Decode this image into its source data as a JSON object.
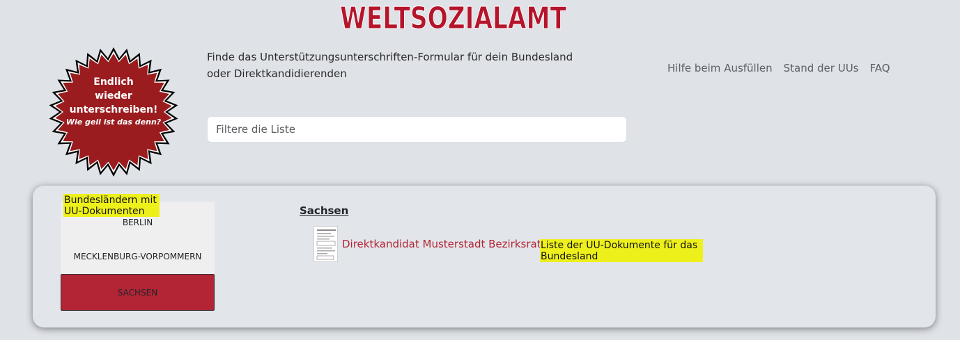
{
  "logo": {
    "text": "WELTSOZIALAMT"
  },
  "badge": {
    "lines": [
      "Endlich",
      "wieder",
      "unterschreiben!"
    ],
    "subline": "Wie geil ist das denn?",
    "color": "#9b1c1f"
  },
  "intro": "Finde das Unterstützungsunterschriften-Formular für dein Bundesland oder Direktkandidierenden",
  "nav": [
    {
      "label": "Hilfe beim Ausfüllen"
    },
    {
      "label": "Stand der UUs"
    },
    {
      "label": "FAQ"
    }
  ],
  "filter": {
    "placeholder": "Filtere die Liste",
    "value": ""
  },
  "states": {
    "annotation": "Bundesländern mit UU-Dokumenten",
    "items": [
      {
        "label": "BERLIN"
      },
      {
        "label": "MECKLENBURG-VORPOMMERN"
      },
      {
        "label": "SACHSEN",
        "selected": true
      }
    ]
  },
  "region": {
    "title": "Sachsen",
    "documents": [
      {
        "label": "Direktkandidat Musterstadt Bezirksrat",
        "icon": "document-thumbnail-icon"
      }
    ],
    "annotation": "Liste der UU-Dokumente für das Bundesland"
  },
  "colors": {
    "accent": "#b32535",
    "highlight": "#eef01c",
    "background": "#dfe2e7"
  }
}
